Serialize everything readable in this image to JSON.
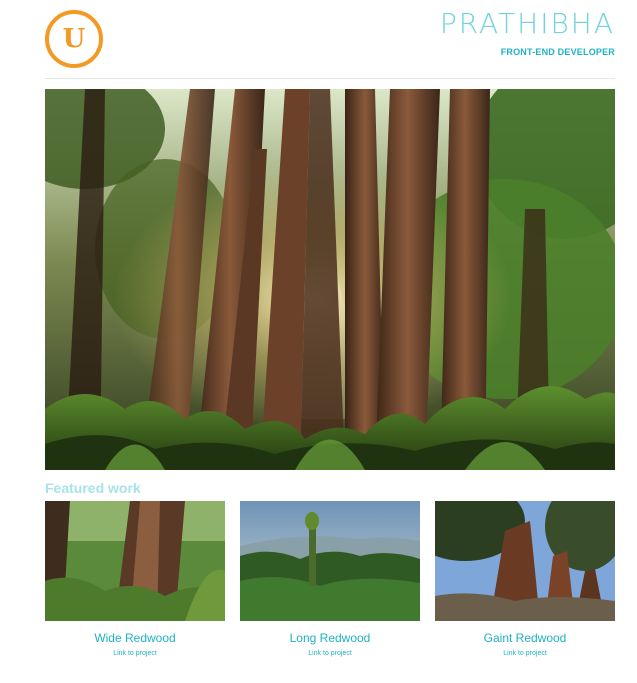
{
  "header": {
    "logo_letter": "U",
    "name": "PRATHIBHA",
    "role": "FRONT-END DEVELOPER"
  },
  "colors": {
    "logo": "#f29a24",
    "accent": "#1fb2c4",
    "name": "#6fd3dd",
    "featured_heading": "#a8e2ea"
  },
  "featured": {
    "heading": "Featured work",
    "cards": [
      {
        "title": "Wide Redwood",
        "link": "Link to project"
      },
      {
        "title": "Long Redwood",
        "link": "Link to project"
      },
      {
        "title": "Gaint Redwood",
        "link": "Link to project"
      }
    ]
  }
}
